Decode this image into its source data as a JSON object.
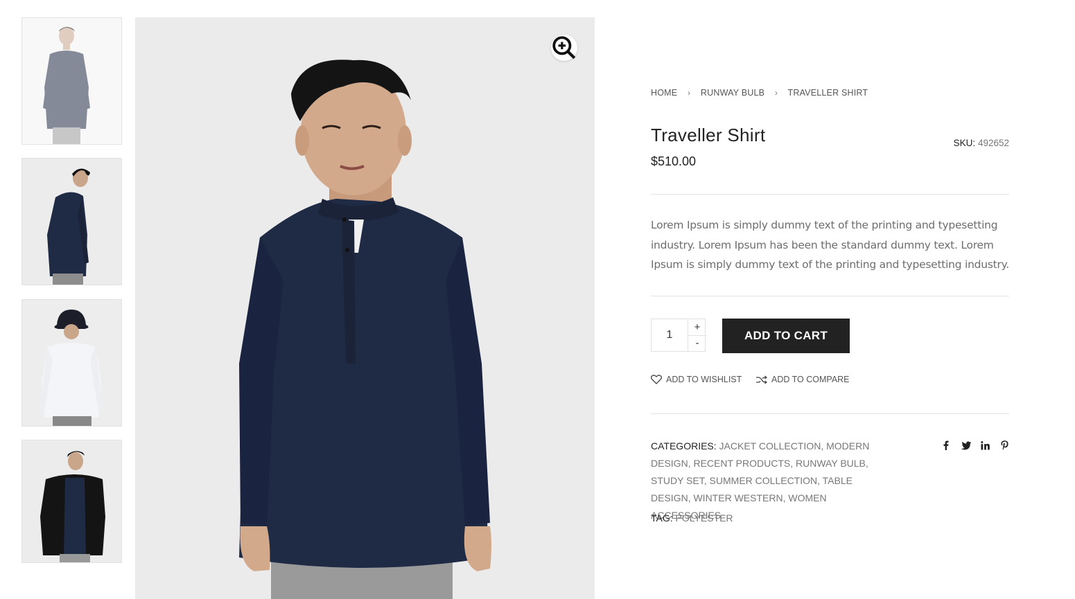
{
  "breadcrumb": [
    {
      "label": "HOME"
    },
    {
      "label": "RUNWAY BULB"
    },
    {
      "label": "TRAVELLER SHIRT"
    }
  ],
  "product": {
    "title": "Traveller Shirt",
    "price": "$510.00",
    "sku_label": "SKU:",
    "sku_value": "492652",
    "description": "Lorem Ipsum is simply dummy text of the printing and typesetting industry. Lorem Ipsum has been the standard dummy text. Lorem Ipsum is simply dummy text of the printing and typesetting industry."
  },
  "cart": {
    "quantity": "1",
    "plus": "+",
    "minus": "-",
    "add_to_cart": "ADD TO CART"
  },
  "actions": {
    "wishlist": "ADD TO WISHLIST",
    "compare": "ADD TO COMPARE"
  },
  "meta": {
    "categories_label": "CATEGORIES:",
    "categories": [
      "JACKET COLLECTION",
      "MODERN DESIGN",
      "RECENT PRODUCTS",
      "RUNWAY BULB",
      "STUDY SET",
      "SUMMER COLLECTION",
      "TABLE DESIGN",
      "WINTER WESTERN",
      "WOMEN ACCESSORIES"
    ],
    "tag_label": "TAG:",
    "tag": "POLYESTER"
  },
  "social": [
    "facebook-icon",
    "twitter-icon",
    "linkedin-icon",
    "pinterest-icon"
  ],
  "gallery": {
    "thumbnails": [
      "navy shirt front",
      "navy shirt side",
      "white shirt with bucket hat",
      "black jacket over navy shirt"
    ],
    "active_thumbnail": 1
  },
  "colors": {
    "primary": "#222222",
    "text_muted": "#777777",
    "image_bg": "#ebebeb",
    "shirt_navy": "#1f2a44"
  }
}
